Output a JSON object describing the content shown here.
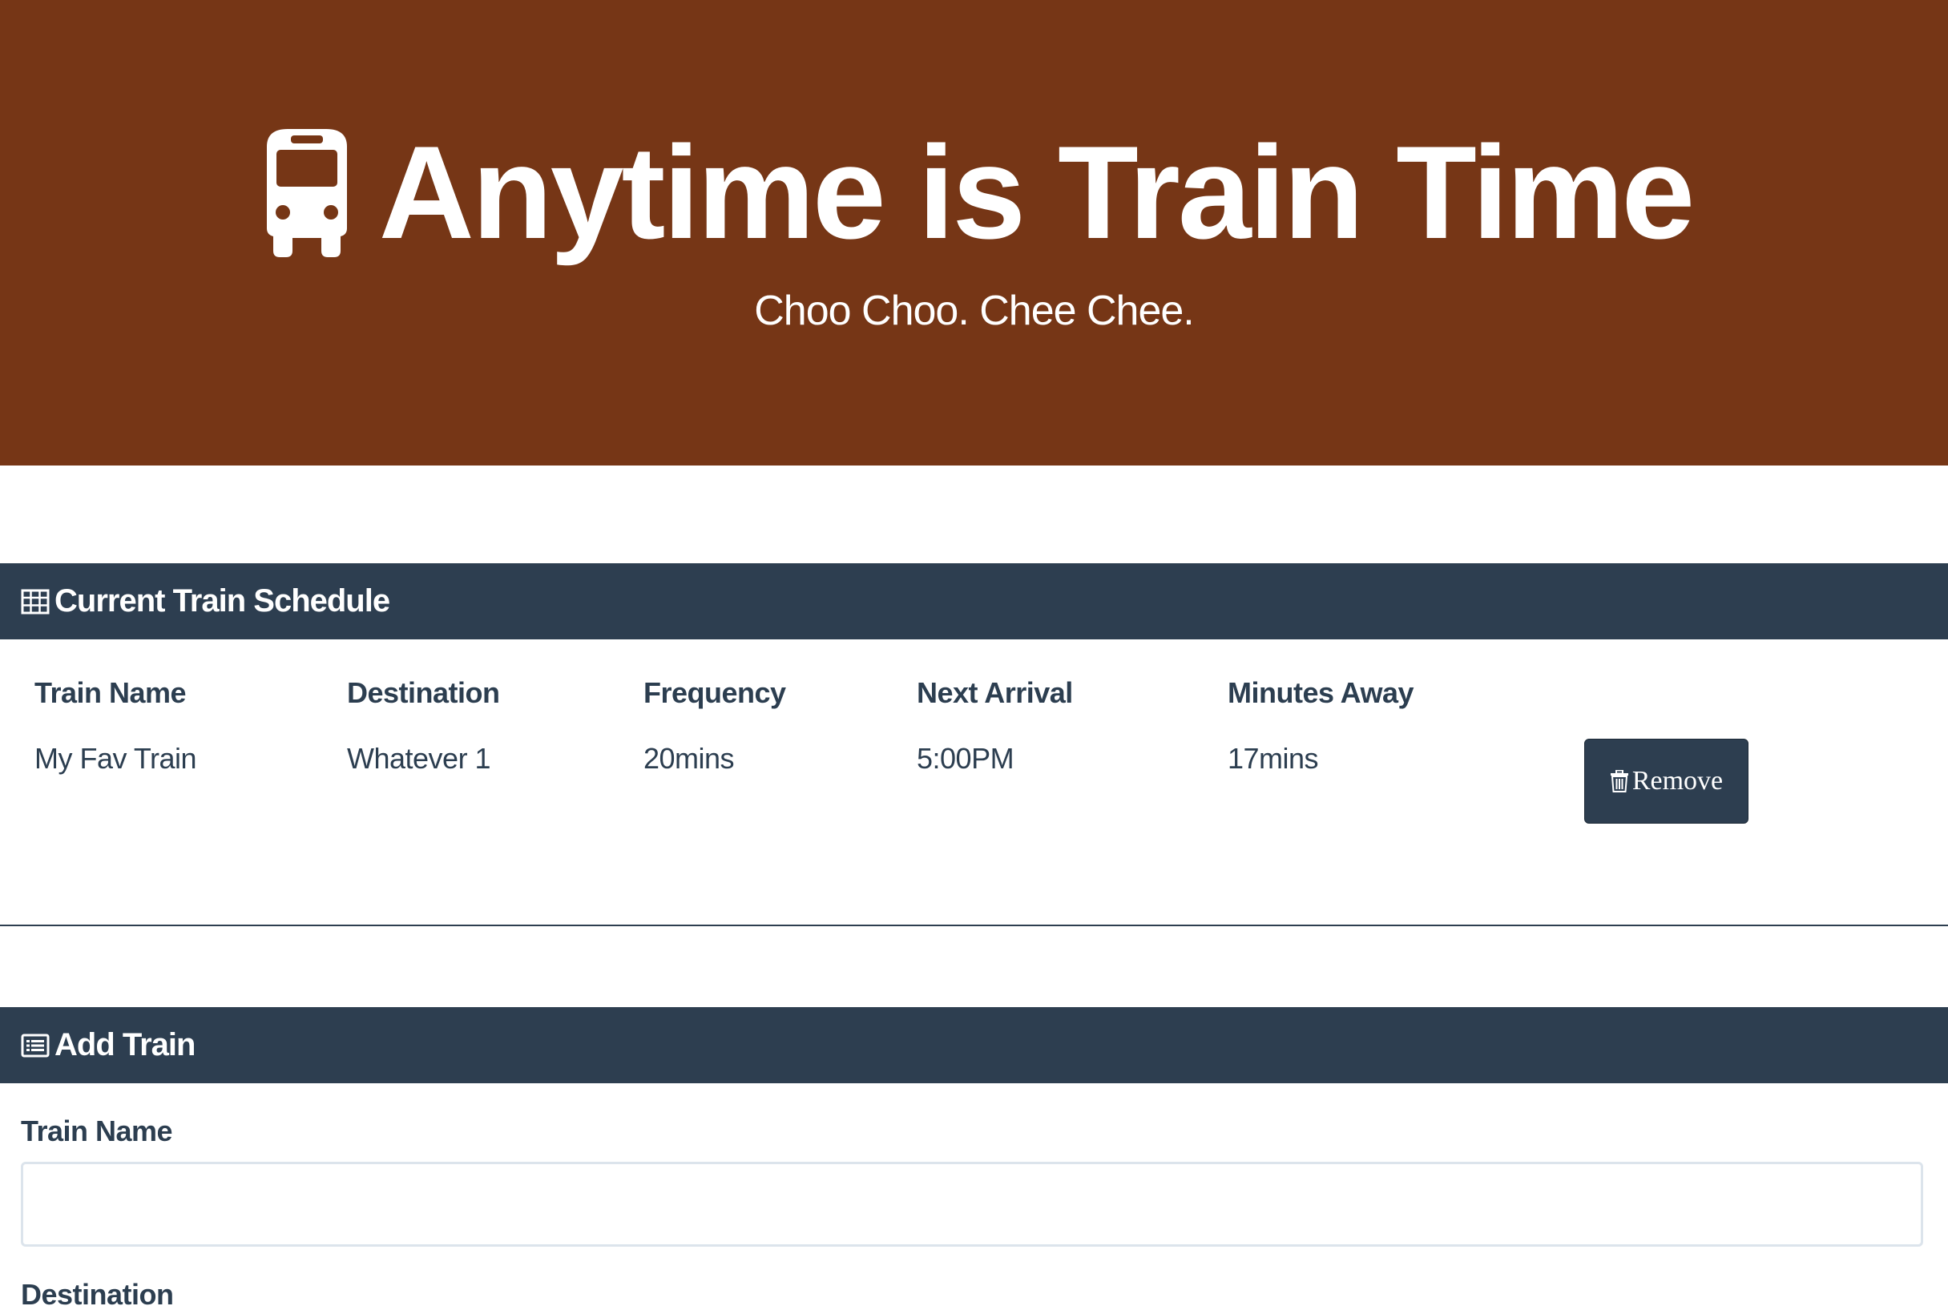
{
  "hero": {
    "title": "Anytime is Train Time",
    "subtitle": "Choo Choo. Chee Chee.",
    "background_color": "#763616",
    "icon": "bus-icon"
  },
  "schedule_panel": {
    "heading": "Current Train Schedule",
    "icon": "table-icon",
    "header_color": "#2d3e50",
    "columns": [
      "Train Name",
      "Destination",
      "Frequency",
      "Next Arrival",
      "Minutes Away"
    ],
    "rows": [
      {
        "train_name": "My Fav Train",
        "destination": "Whatever 1",
        "frequency": "20mins",
        "next_arrival": "5:00PM",
        "minutes_away": "17mins",
        "action_label": "Remove",
        "action_icon": "trash-icon"
      }
    ]
  },
  "add_train_panel": {
    "heading": "Add Train",
    "icon": "list-alt-icon",
    "fields": [
      {
        "label": "Train Name",
        "value": "",
        "placeholder": ""
      },
      {
        "label": "Destination",
        "value": "",
        "placeholder": ""
      }
    ]
  }
}
